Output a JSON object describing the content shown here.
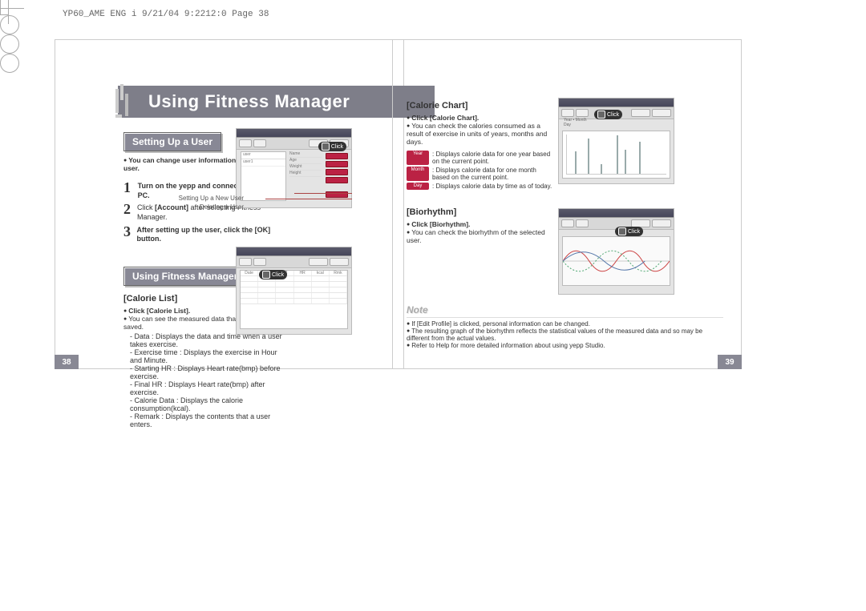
{
  "meta": {
    "header": "YP60_AME ENG i  9/21/04 9:2212:0  Page 38"
  },
  "title": "Using Fitness Manager",
  "left": {
    "section1": "Setting Up a User",
    "s1_bullet": "You can change user information or delete a user.",
    "steps": [
      {
        "n": "1",
        "text_bold": "Turn on the yepp and connect it to your PC."
      },
      {
        "n": "2",
        "text_html": [
          "Click ",
          "[Account]",
          " after selecting Fitness Manager."
        ]
      },
      {
        "n": "3",
        "text_html": [
          "After setting up the user, click the [OK] button."
        ]
      }
    ],
    "callout1": "Setting Up a New User",
    "callout2": "Deleting a User",
    "section2": "Using Fitness Manager",
    "cal_list_head": "[Calorie List]",
    "cal_list_b1": "Click [Calorie List].",
    "cal_list_b2": "You can see the measured data that has been saved.",
    "cal_list_details": [
      "Data : Displays the data and time when a user takes exercise.",
      "Exercise time : Displays the exercise in Hour and Minute.",
      "Starting HR : Displays Heart rate(bmp) before exercise.",
      "Final HR : Displays Heart rate(bmp) after exercise.",
      "Calorie Data : Displays the calorie consumption(kcal).",
      "Remark : Displays the contents that a user enters."
    ],
    "pagenum": "38"
  },
  "right": {
    "cal_chart_head": "[Calorie Chart]",
    "cc_b1": "Click [Calorie Chart].",
    "cc_b2": "You can check the calories consumed as a result of exercise in units of years, months and days.",
    "cc_rows": [
      {
        "pill": "Year",
        "text": "Displays calorie data for one year based on the current point."
      },
      {
        "pill": "Month",
        "text": "Displays calorie data for one month based on the current point."
      },
      {
        "pill": "Day",
        "text": "Displays calorie data by time as of today."
      }
    ],
    "bio_head": "[Biorhythm]",
    "bio_b1": "Click [Biorhythm].",
    "bio_b2": "You can check the biorhythm of the selected user.",
    "note_label": "Note",
    "notes": [
      "If [Edit Profile] is clicked, personal information can be changed.",
      "The resulting graph of the biorhythm reflects the statistical values of the measured data and so may be different from the actual values.",
      "Refer to Help for more detailed information about using yepp Studio."
    ],
    "pagenum": "39"
  },
  "click_label": "Click"
}
